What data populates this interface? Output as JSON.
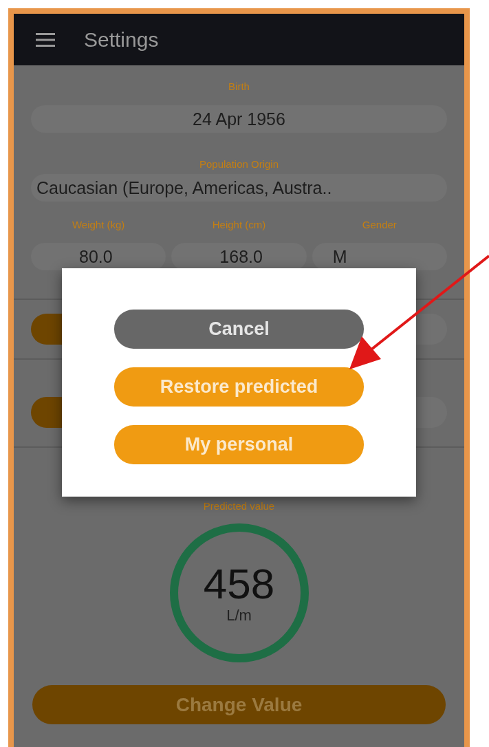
{
  "app_bar": {
    "title": "Settings"
  },
  "birth": {
    "label": "Birth",
    "value": "24 Apr 1956"
  },
  "population_origin": {
    "label": "Population Origin",
    "value": "Caucasian (Europe, Americas, Austra.."
  },
  "measurements": [
    {
      "label": "Weight (kg)",
      "value": "80.0"
    },
    {
      "label": "Height (cm)",
      "value": "168.0"
    },
    {
      "label": "Gender",
      "value": "M"
    }
  ],
  "predicted": {
    "label": "Predicted value",
    "value": "458",
    "unit": "L/m"
  },
  "change_button": "Change Value",
  "dialog": {
    "buttons": [
      {
        "label": "Cancel",
        "kind": "secondary"
      },
      {
        "label": "Restore predicted",
        "kind": "primary"
      },
      {
        "label": "My personal",
        "kind": "primary"
      }
    ]
  }
}
